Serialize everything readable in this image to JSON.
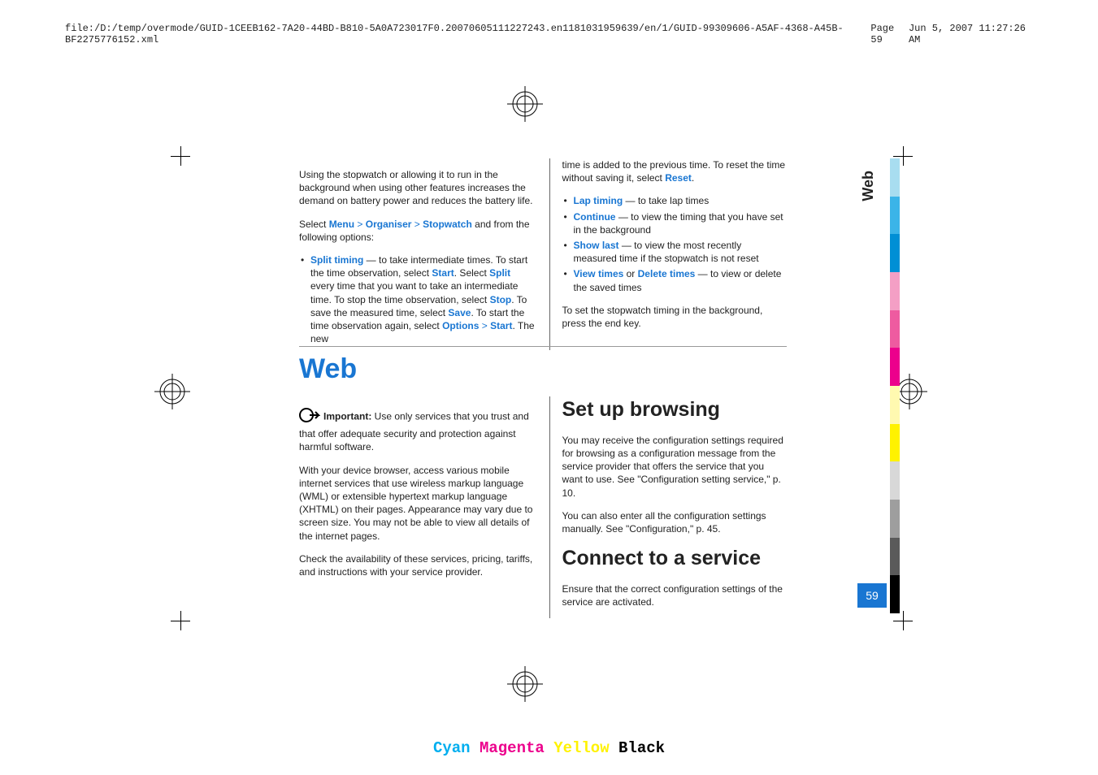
{
  "header": {
    "path": "file:/D:/temp/overmode/GUID-1CEEB162-7A20-44BD-B810-5A0A723017F0.20070605111227243.en1181031959639/en/1/GUID-99309606-A5AF-4368-A45B-BF2275776152.xml",
    "page": "Page 59",
    "date": "Jun 5, 2007 11:27:26 AM"
  },
  "col1": {
    "p1": "Using the stopwatch or allowing it to run in the background when using other features increases the demand on battery power and reduces the battery life.",
    "p2a": "Select ",
    "menu": "Menu",
    "organiser": "Organiser",
    "stopwatch": "Stopwatch",
    "p2b": " and from the following options:",
    "li1a": "Split timing",
    "li1b": " — to take intermediate times. To start the time observation, select ",
    "start": "Start",
    "li1c": ". Select ",
    "split": "Split",
    "li1d": " every time that you want to take an intermediate time. To stop the time observation, select ",
    "stop": "Stop",
    "li1e": ". To save the measured time, select ",
    "save": "Save",
    "li1f": ". To start the time observation again, select ",
    "options": "Options",
    "li1g": ". The new"
  },
  "col2": {
    "p1a": "time is added to the previous time. To reset the time without saving it, select ",
    "reset": "Reset",
    "p1b": ".",
    "lap": "Lap timing",
    "lapb": " — to take lap times",
    "cont": "Continue",
    "contb": " — to view the timing that you have set in the background",
    "show": "Show last",
    "showb": " — to view the most recently measured time if the stopwatch is not reset",
    "viewt": "View times",
    "or": " or ",
    "delt": "Delete times",
    "viewb": " — to view or delete the saved times",
    "p2": "To set the stopwatch timing in the background, press the end key."
  },
  "webheading": "Web",
  "webcol1": {
    "imp": "Important:  ",
    "impb": "Use only services that you trust and that offer adequate security and protection against harmful software.",
    "p2": "With your device browser, access various mobile internet services that use wireless markup language (WML) or extensible hypertext markup language (XHTML) on their pages. Appearance may vary due to screen size. You may not be able to view all details of the internet pages.",
    "p3": "Check the availability of these services, pricing, tariffs, and instructions with your service provider."
  },
  "webcol2": {
    "h1": "Set up browsing",
    "p1": "You may receive the configuration settings required for browsing as a configuration message from the service provider that offers the service that you want to use. See \"Configuration setting service,\" p. 10.",
    "p2": "You can also enter all the configuration settings manually. See \"Configuration,\" p. 45.",
    "h2": "Connect to a service",
    "p3": "Ensure that the correct configuration settings of the service are activated."
  },
  "sidelabel": "Web",
  "pagenum": "59",
  "cmyk": {
    "c": "Cyan",
    "m": "Magenta",
    "y": "Yellow",
    "k": "Black"
  },
  "bars": [
    "#a8ddf0",
    "#3bb4e8",
    "#008fd5",
    "#f49fc5",
    "#ee5ba0",
    "#ec008c",
    "#fff9b0",
    "#fff200",
    "#d8d8d8",
    "#9e9e9e",
    "#5a5a5a",
    "#000"
  ]
}
